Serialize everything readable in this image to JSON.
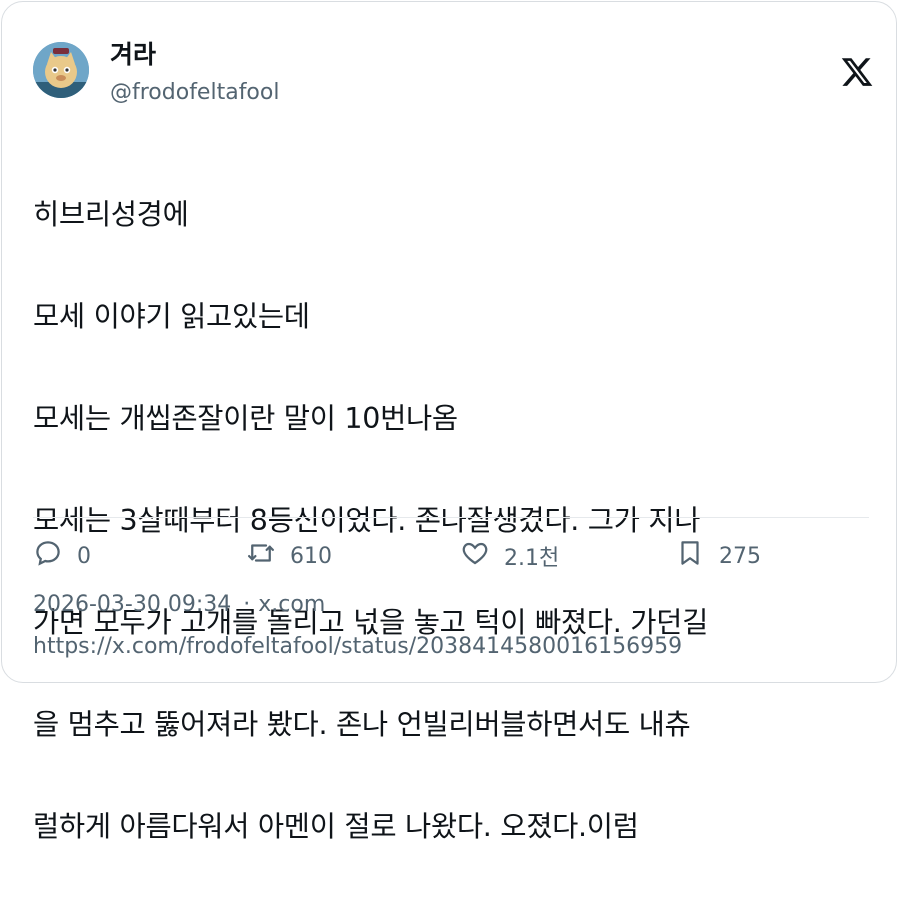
{
  "author": {
    "name": "겨라",
    "handle": "@frodofeltafool"
  },
  "tweet": {
    "lines": [
      "히브리성경에",
      "모세 이야기 읽고있는데",
      "모세는 개씹존잘이란 말이 10번나옴",
      "모세는 3살때부터 8등신이었다. 존나잘생겼다. 그가 지나",
      "가면 모두가 고개를 돌리고 넋을 놓고 턱이 빠졌다. 가던길",
      "을 멈추고 뚫어져라 봤다. 존나 언빌리버블하면서도 내츄",
      "럴하게 아름다워서 아멘이 절로 나왔다. 오졌다.이럼"
    ]
  },
  "actions": {
    "replies": "0",
    "retweets": "610",
    "likes": "2.1천",
    "bookmarks": "275"
  },
  "meta": {
    "timestamp": "2026-03-30 09:34",
    "separator": "·",
    "source": "x.com",
    "url": "https://x.com/frodofeltafool/status/2038414580016156959"
  },
  "icons": {
    "reply": "speech-bubble-icon",
    "retweet": "retweet-arrows-icon",
    "like": "heart-icon",
    "bookmark": "bookmark-icon",
    "brand": "x-logo-icon"
  }
}
